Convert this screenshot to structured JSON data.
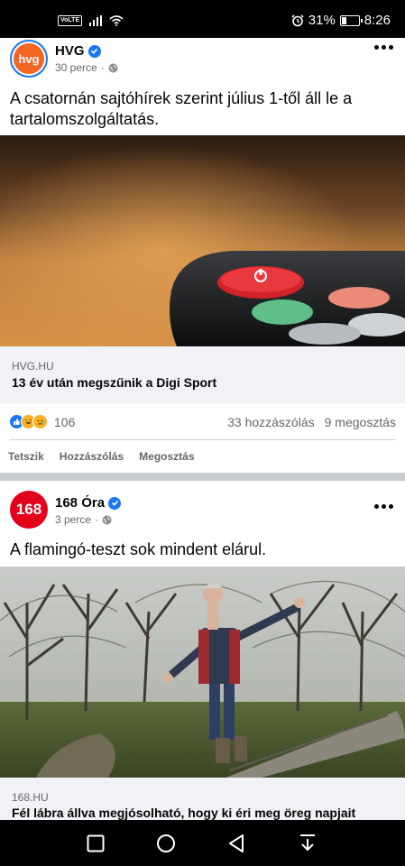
{
  "status_bar": {
    "network": "VoLTE",
    "battery": "31%",
    "time": "8:26",
    "battery_level": 0.31
  },
  "posts": [
    {
      "author": "HVG",
      "time": "30 perce",
      "avatar_text": "hvg",
      "text": "A csatornán sajtóhírek szerint július 1-től áll le a tartalomszolgáltatás.",
      "link_domain": "HVG.HU",
      "link_title": "13 év után megszűnik a Digi Sport",
      "reactions_count": "106",
      "comments": "33 hozzászólás",
      "shares": "9 megosztás"
    },
    {
      "author": "168 Óra",
      "time": "3 perce",
      "avatar_text": "168",
      "text": "A flamingó-teszt sok mindent elárul.",
      "link_domain": "168.HU",
      "link_title": "Fél lábra állva megjósolható, hogy ki éri meg öreg napjait"
    }
  ],
  "actions": {
    "like": "Tetszik",
    "comment": "Hozzászólás",
    "share": "Megosztás"
  },
  "colors": {
    "hvg_orange": "#f26522",
    "red_168": "#e2001a",
    "fb_blue": "#1877f2",
    "reaction_yellow": "#f7b125"
  }
}
